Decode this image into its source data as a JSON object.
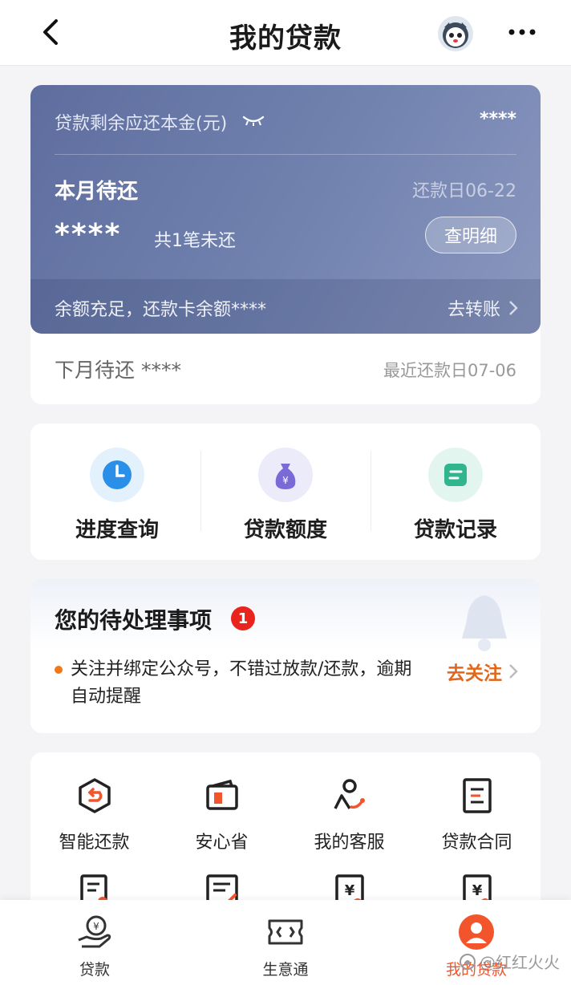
{
  "header": {
    "title": "我的贷款"
  },
  "loan_card": {
    "remaining_label": "贷款剩余应还本金(元)",
    "remaining_value": "****",
    "month_title": "本月待还",
    "due_date": "还款日06-22",
    "month_amount": "****",
    "unpaid_count": "共1笔未还",
    "detail_button": "查明细",
    "balance_text": "余额充足，还款卡余额****",
    "transfer_link": "去转账",
    "next_month_label": "下月待还 ****",
    "next_due_date": "最近还款日07-06"
  },
  "quick_actions": [
    {
      "label": "进度查询",
      "icon": "clock-icon",
      "color": "#2a8fe8"
    },
    {
      "label": "贷款额度",
      "icon": "money-bag-icon",
      "color": "#7a6ad8"
    },
    {
      "label": "贷款记录",
      "icon": "record-icon",
      "color": "#31b58c"
    }
  ],
  "pending": {
    "title": "您的待处理事项",
    "badge_count": "1",
    "item_text": "关注并绑定公众号，不错过放款/还款，逾期自动提醒",
    "action_label": "去关注"
  },
  "services": [
    {
      "label": "智能还款",
      "icon": "smart-repay-icon"
    },
    {
      "label": "安心省",
      "icon": "wallet-icon"
    },
    {
      "label": "我的客服",
      "icon": "customer-service-icon"
    },
    {
      "label": "贷款合同",
      "icon": "contract-icon"
    },
    {
      "label": "",
      "icon": "document-edit-icon"
    },
    {
      "label": "",
      "icon": "document-edit-icon"
    },
    {
      "label": "",
      "icon": "yuan-document-icon"
    },
    {
      "label": "",
      "icon": "yuan-document-icon"
    }
  ],
  "bottom_nav": [
    {
      "label": "贷款",
      "icon": "loan-hand-icon",
      "active": false
    },
    {
      "label": "生意通",
      "icon": "ticket-icon",
      "active": false
    },
    {
      "label": "我的贷款",
      "icon": "person-icon",
      "active": true
    }
  ],
  "watermark": "@红红火火",
  "colors": {
    "accent": "#f2552c",
    "card": "#6a79a8",
    "link": "#e2661b"
  }
}
